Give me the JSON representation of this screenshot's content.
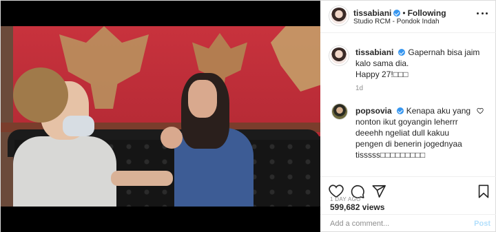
{
  "post": {
    "author": "tissabiani",
    "follow_status": "Following",
    "location": "Studio RCM - Pondok Indah",
    "caption_line1": "Gapernah bisa jaim kalo sama dia.",
    "caption_line2": "Happy 27!□□□",
    "caption_age": "1d"
  },
  "comments": [
    {
      "username": "popsovia",
      "text": "Kenapa aku yang nonton ikut goyangin leherrr deeehh ngeliat dull kakuu pengen di benerin jogednyaa tisssss□□□□□□□□□"
    }
  ],
  "stats": {
    "views": "599,682 views",
    "time_ago": "1 DAY AGO"
  },
  "composer": {
    "placeholder": "Add a comment...",
    "post_label": "Post"
  },
  "icons": {
    "verified": "verified-badge-icon",
    "more": "more-options-icon",
    "like": "heart-icon",
    "comment": "comment-icon",
    "share": "share-icon",
    "save": "bookmark-icon",
    "sound": "speaker-icon",
    "tagged": "user-tag-icon"
  },
  "colors": {
    "verified_blue": "#3897f0",
    "post_button_disabled": "#b2dffc",
    "secondary_text": "#8e8e8e"
  }
}
